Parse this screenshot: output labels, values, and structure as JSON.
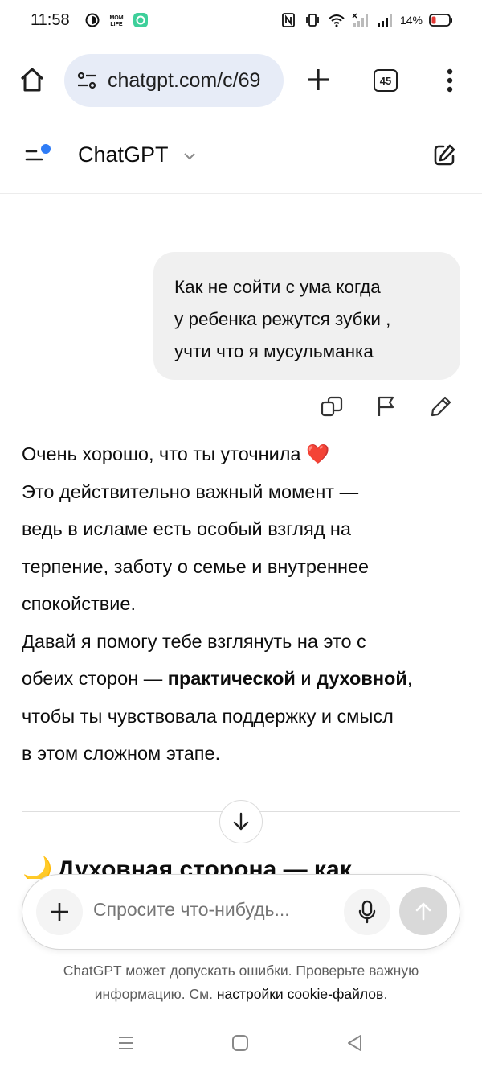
{
  "status": {
    "time": "11:58",
    "battery": "14%",
    "left_icons": [
      "ring-icon",
      "momlife-app-icon",
      "chat-app-icon"
    ],
    "right_icons": [
      "nfc-icon",
      "vibrate-icon",
      "wifi-icon",
      "signal-weak-icon",
      "signal-icon",
      "battery-low-icon"
    ]
  },
  "browser": {
    "url": "chatgpt.com/c/69",
    "tab_count": "45"
  },
  "header": {
    "title": "ChatGPT"
  },
  "conversation": {
    "user_message": {
      "lines": [
        "Как не сойти с ума когда",
        "у ребенка режутся зубки ,",
        "учти что я мусульманка"
      ]
    },
    "assistant_message": {
      "line1": "Очень хорошо, что ты уточнила",
      "emoji": "❤️",
      "line2": "Это действительно важный момент —",
      "line3": "ведь в исламе есть особый взгляд на",
      "line4": "терпение, заботу о семье и внутреннее",
      "line5": "спокойствие.",
      "line6": "Давай я помогу тебе взглянуть на это с",
      "line7_prefix": "обеих сторон — ",
      "line7_bold1": "практической",
      "line7_mid": " и ",
      "line7_bold2": "духовной",
      "line7_suffix": ",",
      "line8": "чтобы ты чувствовала поддержку и смысл",
      "line9": "в этом сложном этапе."
    },
    "next_heading": {
      "emoji": "🌙",
      "text": "Духовная сторона — как"
    }
  },
  "composer": {
    "placeholder": "Спросите что-нибудь..."
  },
  "disclaimer": {
    "text": "ChatGPT может допускать ошибки. Проверьте важную информацию. См. ",
    "link": "настройки cookie-файлов",
    "end": "."
  },
  "colors": {
    "accent_dot": "#2f7cf6",
    "user_bubble": "#f0f0f0",
    "url_pill": "#e7ecf7",
    "heart": "#e0245e"
  }
}
